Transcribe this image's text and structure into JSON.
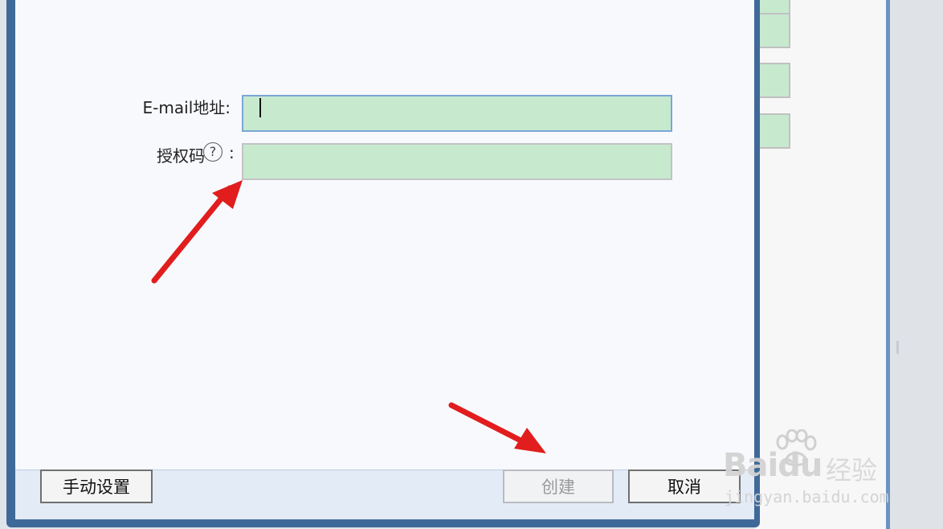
{
  "form": {
    "email_label": "E-mail地址:",
    "auth_label": "授权码",
    "auth_colon": ":",
    "help_symbol": "?",
    "email_value": "",
    "auth_value": ""
  },
  "footer": {
    "manual_button": "手动设置",
    "create_button": "创建",
    "cancel_button": "取消"
  },
  "watermark": {
    "brand": "Baidu",
    "sub": "经验",
    "domain": "jingyan.baidu.com"
  },
  "colors": {
    "input_fill": "#c7eacf",
    "focus_border": "#7aa7d6",
    "dialog_frame": "#3f6998",
    "annotation_arrow": "#e11d1d"
  },
  "icons": {
    "help": "question-circle-icon",
    "watermark_logo": "baidu-paw-icon"
  }
}
